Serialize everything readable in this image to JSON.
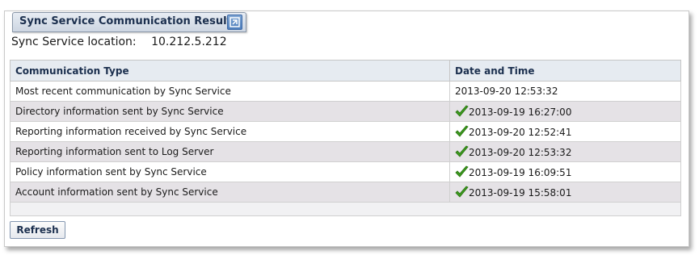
{
  "panel": {
    "title": "Sync Service Communication Results",
    "collapse_icon": "collapse-icon"
  },
  "location": {
    "label": "Sync Service location:",
    "value": "10.212.5.212"
  },
  "table": {
    "headers": [
      "Communication Type",
      "Date and Time"
    ],
    "rows": [
      {
        "type": "Most recent communication by Sync Service",
        "datetime": "2013-09-20 12:53:32",
        "status_icon": null
      },
      {
        "type": "Directory information sent by Sync Service",
        "datetime": "2013-09-19 16:27:00",
        "status_icon": "check-icon"
      },
      {
        "type": "Reporting information received by Sync Service",
        "datetime": "2013-09-20 12:52:41",
        "status_icon": "check-icon"
      },
      {
        "type": "Reporting information sent to Log Server",
        "datetime": "2013-09-20 12:53:32",
        "status_icon": "check-icon"
      },
      {
        "type": "Policy information sent by Sync Service",
        "datetime": "2013-09-19 16:09:51",
        "status_icon": "check-icon"
      },
      {
        "type": "Account information sent by Sync Service",
        "datetime": "2013-09-19 15:58:01",
        "status_icon": "check-icon"
      }
    ]
  },
  "actions": {
    "refresh_label": "Refresh"
  },
  "colors": {
    "header_text": "#1b2f4e",
    "alt_row": "#e5e2e6",
    "check_green": "#3c9a1e"
  }
}
